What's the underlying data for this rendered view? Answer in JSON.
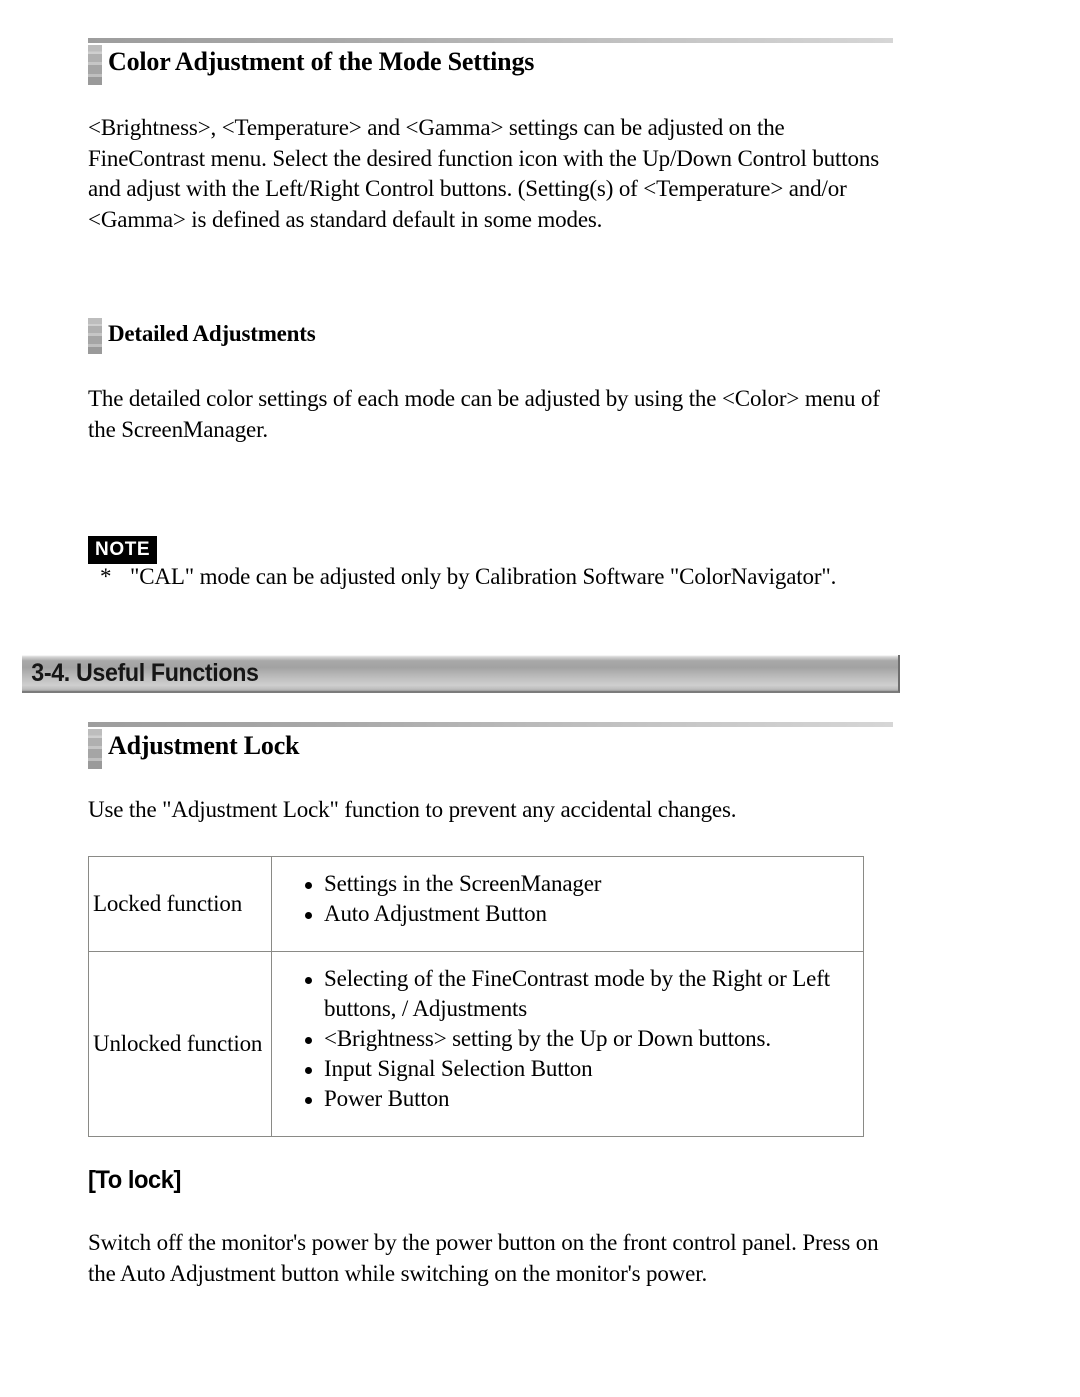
{
  "document": {
    "section_title": "3-4. Useful Functions"
  },
  "headings": {
    "color_adjustment": "Color Adjustment of the Mode Settings",
    "detailed_adjustments": "Detailed Adjustments",
    "adjustment_lock": "Adjustment Lock",
    "to_lock": "[To lock]"
  },
  "paragraphs": {
    "color_adjustment_body": "<Brightness>, <Temperature> and <Gamma> settings can be adjusted on the FineContrast menu. Select the desired function icon with the Up/Down Control buttons and adjust with the Left/Right Control buttons. (Setting(s) of <Temperature> and/or <Gamma> is defined as standard default in some modes.",
    "detailed_adjustments_body": "The detailed color settings of each mode can be adjusted by using the <Color> menu of the ScreenManager.",
    "adjustment_lock_body": "Use the \"Adjustment Lock\" function to prevent any accidental changes.",
    "to_lock_body": "Switch off the monitor's power by the power button on the front control panel. Press on the Auto Adjustment button while switching on the monitor's power."
  },
  "note": {
    "badge_label": "NOTE",
    "star": "*",
    "text": "\"CAL\" mode can be adjusted only by Calibration Software \"ColorNavigator\"."
  },
  "lock_table": {
    "rows": [
      {
        "label": "Locked function",
        "items": [
          "Settings in the ScreenManager",
          "Auto Adjustment Button"
        ]
      },
      {
        "label": "Unlocked function",
        "items": [
          "Selecting of the FineContrast mode by the Right or Left buttons, / Adjustments",
          "<Brightness> setting by the Up or Down buttons.",
          "Input Signal Selection Button",
          "Power Button"
        ]
      }
    ]
  },
  "colors": {
    "rule_gradient_start": "#9d9d9d",
    "rule_gradient_end": "#d6d6d6",
    "marker_gray": "#b0b0b0",
    "section_bar_gray": "#a9a9a9",
    "table_border": "#8a8a86",
    "note_badge_bg": "#000000",
    "text": "#000000"
  }
}
